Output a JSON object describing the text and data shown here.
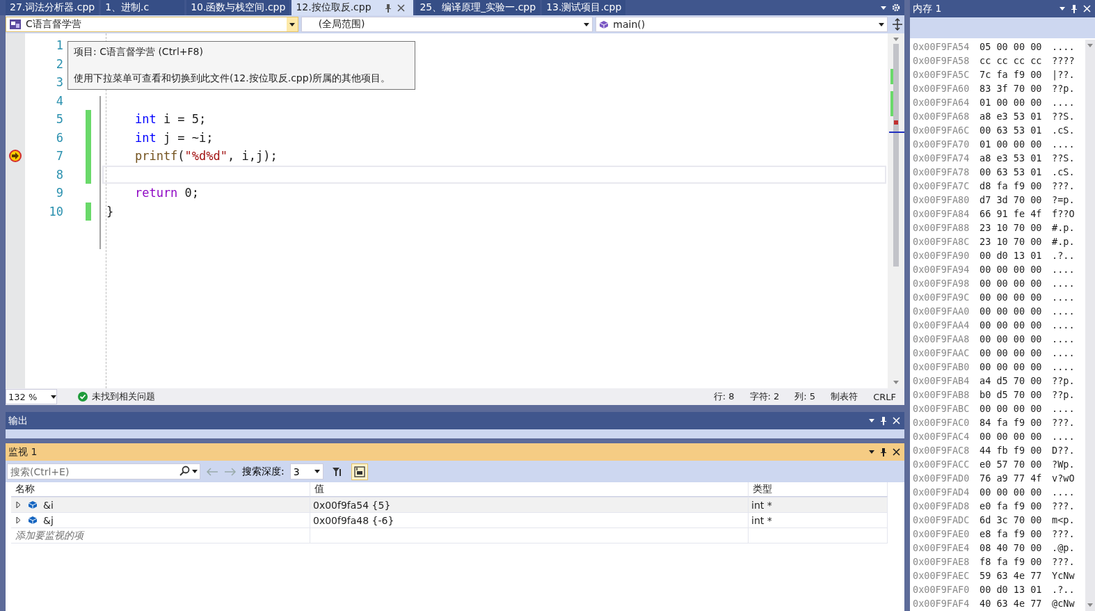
{
  "tabs": [
    {
      "label": "27.词法分析器.cpp",
      "selected": false
    },
    {
      "label": "1、进制.c",
      "selected": false
    },
    {
      "label": "10.函数与栈空间.cpp",
      "selected": false
    },
    {
      "label": "12.按位取反.cpp",
      "selected": true
    },
    {
      "label": "25、编译原理_实验一.cpp",
      "selected": false
    },
    {
      "label": "13.测试项目.cpp",
      "selected": false
    }
  ],
  "nav": {
    "project": "C语言督学营",
    "scope": "(全局范围)",
    "function": "main()"
  },
  "tooltip": {
    "title": "项目: C语言督学营 (Ctrl+F8)",
    "body": "使用下拉菜单可查看和切换到此文件(12.按位取反.cpp)所属的其他项目。"
  },
  "code_lines": [
    {
      "number": "1",
      "changed": false,
      "current": false,
      "cursor": false
    },
    {
      "number": "2",
      "changed": false,
      "current": false,
      "cursor": false
    },
    {
      "number": "3",
      "changed": false,
      "current": false,
      "cursor": false
    },
    {
      "number": "4",
      "changed": false,
      "current": false,
      "cursor": false
    },
    {
      "number": "5",
      "changed": true,
      "current": false,
      "cursor": false,
      "tokens": [
        {
          "kind": "keyword",
          "text": "    int"
        },
        {
          "kind": "plain",
          "text": " i = 5;"
        }
      ]
    },
    {
      "number": "6",
      "changed": true,
      "current": false,
      "cursor": false,
      "tokens": [
        {
          "kind": "keyword",
          "text": "    int"
        },
        {
          "kind": "plain",
          "text": " j = ~i;"
        }
      ]
    },
    {
      "number": "7",
      "changed": true,
      "current": true,
      "cursor": false,
      "tokens": [
        {
          "kind": "function",
          "text": "    printf"
        },
        {
          "kind": "plain",
          "text": "("
        },
        {
          "kind": "string",
          "text": "\"%d%d\""
        },
        {
          "kind": "plain",
          "text": ", i,j);"
        }
      ]
    },
    {
      "number": "8",
      "changed": true,
      "current": false,
      "cursor": true
    },
    {
      "number": "9",
      "changed": false,
      "current": false,
      "cursor": false,
      "tokens": [
        {
          "kind": "control",
          "text": "    return"
        },
        {
          "kind": "plain",
          "text": " 0;"
        }
      ]
    },
    {
      "number": "10",
      "changed": true,
      "current": false,
      "cursor": false,
      "tokens": [
        {
          "kind": "plain",
          "text": "}"
        }
      ]
    }
  ],
  "status_bar": {
    "zoom": "132 %",
    "issues": "未找到相关问题",
    "items": [
      "行: 8",
      "字符: 2",
      "列: 5",
      "制表符",
      "CRLF"
    ]
  },
  "output_panel": {
    "title": "输出"
  },
  "watch_panel": {
    "title": "监视 1",
    "search_placeholder": "搜索(Ctrl+E)",
    "depth_label": "搜索深度:",
    "depth": "3",
    "columns": [
      "名称",
      "值",
      "类型"
    ],
    "rows": [
      {
        "name": "&i",
        "value": "0x00f9fa54 {5}",
        "type": "int *",
        "expanded": false
      },
      {
        "name": "&j",
        "value": "0x00f9fa48 {-6}",
        "type": "int *",
        "expanded": false
      }
    ],
    "add_placeholder": "添加要监视的项"
  },
  "memory_panel": {
    "title": "内存 1",
    "rows": [
      {
        "address": "0x00F9FA54",
        "bytes": "05 00 00 00",
        "chars": "...."
      },
      {
        "address": "0x00F9FA58",
        "bytes": "cc cc cc cc",
        "chars": "????"
      },
      {
        "address": "0x00F9FA5C",
        "bytes": "7c fa f9 00",
        "chars": "|??."
      },
      {
        "address": "0x00F9FA60",
        "bytes": "83 3f 70 00",
        "chars": "??p."
      },
      {
        "address": "0x00F9FA64",
        "bytes": "01 00 00 00",
        "chars": "...."
      },
      {
        "address": "0x00F9FA68",
        "bytes": "a8 e3 53 01",
        "chars": "??S."
      },
      {
        "address": "0x00F9FA6C",
        "bytes": "00 63 53 01",
        "chars": ".cS."
      },
      {
        "address": "0x00F9FA70",
        "bytes": "01 00 00 00",
        "chars": "...."
      },
      {
        "address": "0x00F9FA74",
        "bytes": "a8 e3 53 01",
        "chars": "??S."
      },
      {
        "address": "0x00F9FA78",
        "bytes": "00 63 53 01",
        "chars": ".cS."
      },
      {
        "address": "0x00F9FA7C",
        "bytes": "d8 fa f9 00",
        "chars": "???."
      },
      {
        "address": "0x00F9FA80",
        "bytes": "d7 3d 70 00",
        "chars": "?=p."
      },
      {
        "address": "0x00F9FA84",
        "bytes": "66 91 fe 4f",
        "chars": "f??O"
      },
      {
        "address": "0x00F9FA88",
        "bytes": "23 10 70 00",
        "chars": "#.p."
      },
      {
        "address": "0x00F9FA8C",
        "bytes": "23 10 70 00",
        "chars": "#.p."
      },
      {
        "address": "0x00F9FA90",
        "bytes": "00 d0 13 01",
        "chars": ".?.."
      },
      {
        "address": "0x00F9FA94",
        "bytes": "00 00 00 00",
        "chars": "...."
      },
      {
        "address": "0x00F9FA98",
        "bytes": "00 00 00 00",
        "chars": "...."
      },
      {
        "address": "0x00F9FA9C",
        "bytes": "00 00 00 00",
        "chars": "...."
      },
      {
        "address": "0x00F9FAA0",
        "bytes": "00 00 00 00",
        "chars": "...."
      },
      {
        "address": "0x00F9FAA4",
        "bytes": "00 00 00 00",
        "chars": "...."
      },
      {
        "address": "0x00F9FAA8",
        "bytes": "00 00 00 00",
        "chars": "...."
      },
      {
        "address": "0x00F9FAAC",
        "bytes": "00 00 00 00",
        "chars": "...."
      },
      {
        "address": "0x00F9FAB0",
        "bytes": "00 00 00 00",
        "chars": "...."
      },
      {
        "address": "0x00F9FAB4",
        "bytes": "a4 d5 70 00",
        "chars": "??p."
      },
      {
        "address": "0x00F9FAB8",
        "bytes": "b0 d5 70 00",
        "chars": "??p."
      },
      {
        "address": "0x00F9FABC",
        "bytes": "00 00 00 00",
        "chars": "...."
      },
      {
        "address": "0x00F9FAC0",
        "bytes": "84 fa f9 00",
        "chars": "???."
      },
      {
        "address": "0x00F9FAC4",
        "bytes": "00 00 00 00",
        "chars": "...."
      },
      {
        "address": "0x00F9FAC8",
        "bytes": "44 fb f9 00",
        "chars": "D??."
      },
      {
        "address": "0x00F9FACC",
        "bytes": "e0 57 70 00",
        "chars": "?Wp."
      },
      {
        "address": "0x00F9FAD0",
        "bytes": "76 a9 77 4f",
        "chars": "v?wO"
      },
      {
        "address": "0x00F9FAD4",
        "bytes": "00 00 00 00",
        "chars": "...."
      },
      {
        "address": "0x00F9FAD8",
        "bytes": "e0 fa f9 00",
        "chars": "???."
      },
      {
        "address": "0x00F9FADC",
        "bytes": "6d 3c 70 00",
        "chars": "m<p."
      },
      {
        "address": "0x00F9FAE0",
        "bytes": "e8 fa f9 00",
        "chars": "???."
      },
      {
        "address": "0x00F9FAE4",
        "bytes": "08 40 70 00",
        "chars": ".@p."
      },
      {
        "address": "0x00F9FAE8",
        "bytes": "f8 fa f9 00",
        "chars": "???."
      },
      {
        "address": "0x00F9FAEC",
        "bytes": "59 63 4e 77",
        "chars": "YcNw"
      },
      {
        "address": "0x00F9FAF0",
        "bytes": "00 d0 13 01",
        "chars": ".?.."
      },
      {
        "address": "0x00F9FAF4",
        "bytes": "40 63 4e 77",
        "chars": "@cNw"
      }
    ]
  }
}
